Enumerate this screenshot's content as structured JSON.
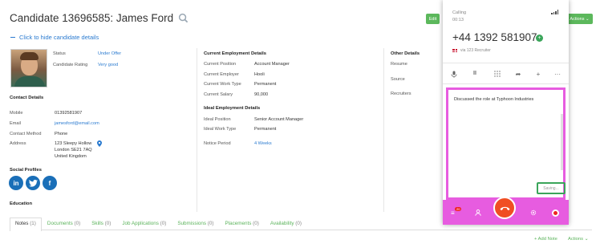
{
  "header": {
    "title": "Candidate 13696585: James Ford",
    "hide_link": "Click to hide candidate details",
    "edit_label": "Edit",
    "actions_label": "Actions"
  },
  "profile": {
    "status_label": "Status",
    "status_value": "Under Offer",
    "rating_label": "Candidate Rating",
    "rating_value": "Very good"
  },
  "contact": {
    "heading": "Contact Details",
    "mobile_label": "Mobile",
    "mobile_value": "01392581907",
    "email_label": "Email",
    "email_value": "jamesford@email.com",
    "method_label": "Contact Method",
    "method_value": "Phone",
    "address_label": "Address",
    "address_line1": "123 Sleepy Hollow",
    "address_line2": "London   SE21 7AQ",
    "address_line3": "United Kingdom"
  },
  "social": {
    "heading": "Social Profiles",
    "icons": [
      "linkedin-icon",
      "twitter-icon",
      "facebook-icon"
    ]
  },
  "education": {
    "heading": "Education"
  },
  "employment": {
    "heading": "Current Employment Details",
    "position_label": "Current Position",
    "position_value": "Account Manager",
    "employer_label": "Current Employer",
    "employer_value": "Hooli",
    "worktype_label": "Current Work Type",
    "worktype_value": "Permanent",
    "salary_label": "Current Salary",
    "salary_value": "90,000"
  },
  "ideal": {
    "heading": "Ideal Employment Details",
    "position_label": "Ideal Position",
    "position_value": "Senior Account Manager",
    "worktype_label": "Ideal Work Type",
    "worktype_value": "Permanent",
    "notice_label": "Notice Period",
    "notice_value": "4 Weeks"
  },
  "other": {
    "heading": "Other Details",
    "resume_label": "Resume",
    "source_label": "Source",
    "recruiters_label": "Recruiters"
  },
  "tabs": [
    {
      "label": "Notes",
      "count": "(1)"
    },
    {
      "label": "Documents",
      "count": "(0)"
    },
    {
      "label": "Skills",
      "count": "(0)"
    },
    {
      "label": "Job Applications",
      "count": "(0)"
    },
    {
      "label": "Submissions",
      "count": "(0)"
    },
    {
      "label": "Placements",
      "count": "(0)"
    },
    {
      "label": "Availability",
      "count": "(0)"
    }
  ],
  "footer": {
    "add_note": "+ Add Note",
    "actions": "Actions"
  },
  "phone": {
    "status": "Calling",
    "timer": "00:13",
    "number": "+44 1392 581907",
    "via": "via 123 Recruiter",
    "note_text": "Discussed the role at Typhoon Industries",
    "saving_label": "Saving...",
    "badge_count": "20",
    "accent_color": "#e75ce0",
    "hangup_color": "#f04e23"
  }
}
